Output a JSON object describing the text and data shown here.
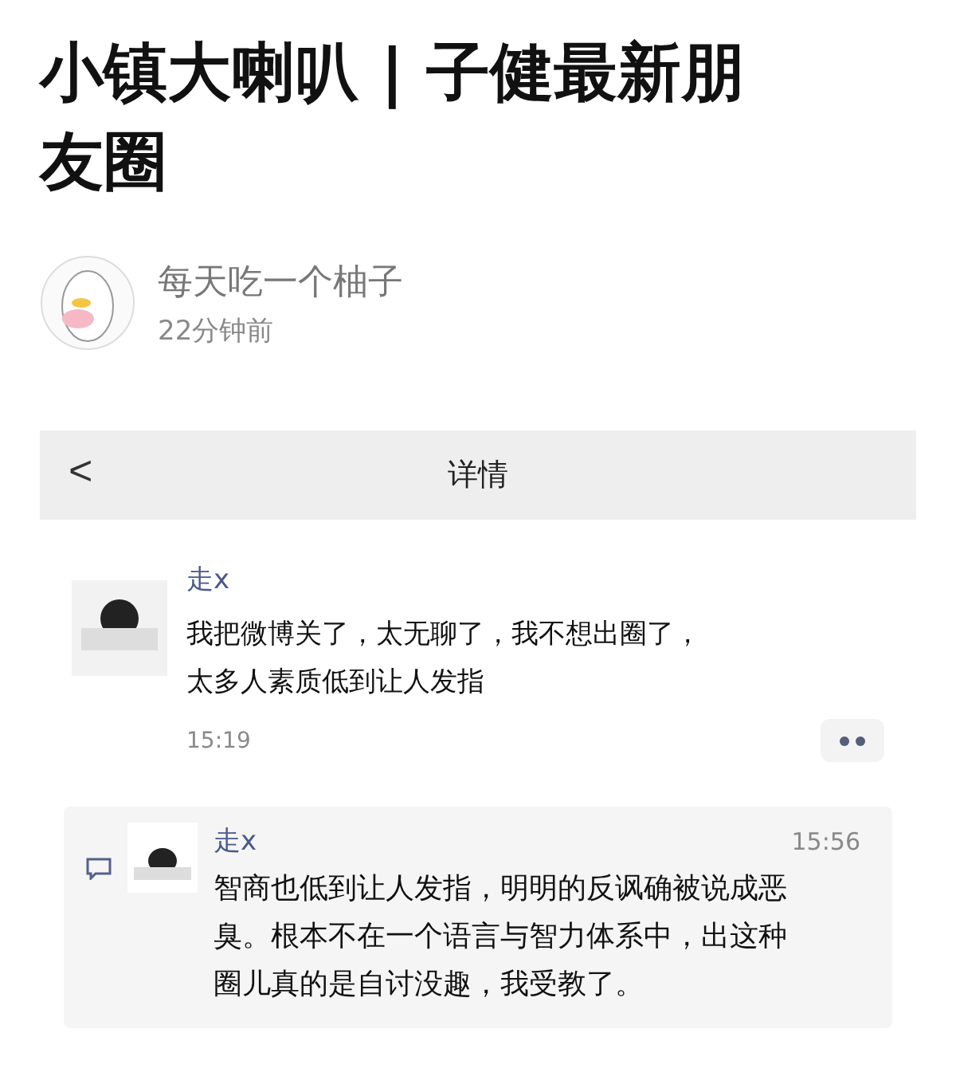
{
  "title": "小镇大喇叭 | 子健最新朋友圈",
  "author": {
    "name": "每天吃一个柚子",
    "time": "22分钟前"
  },
  "screenshot": {
    "header": {
      "back": "<",
      "title": "详情"
    },
    "post": {
      "user": "走x",
      "text": "我把微博关了，太无聊了，我不想出圈了，太多人素质低到让人发指",
      "time": "15:19"
    },
    "reply": {
      "user": "走x",
      "time": "15:56",
      "text": "智商也低到让人发指，明明的反讽确被说成恶臭。根本不在一个语言与智力体系中，出这种圈儿真的是自讨没趣，我受教了。"
    }
  }
}
